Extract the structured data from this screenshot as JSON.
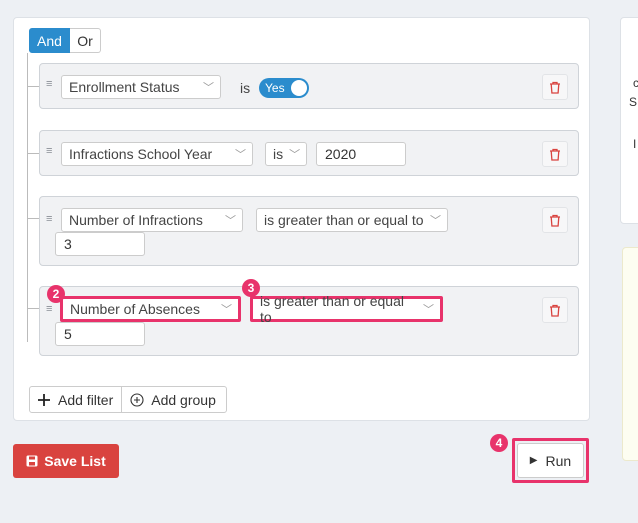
{
  "group": {
    "and_label": "And",
    "or_label": "Or"
  },
  "rules": [
    {
      "field": "Enrollment Status",
      "operator": "is",
      "toggle_label": "Yes"
    },
    {
      "field": "Infractions School Year",
      "operator": "is",
      "value": "2020"
    },
    {
      "field": "Number of Infractions",
      "operator": "is greater than or equal to",
      "value": "3"
    },
    {
      "field": "Number of Absences",
      "operator": "is greater than or equal to",
      "value": "5"
    }
  ],
  "annotations": {
    "badge_field": "2",
    "badge_operator": "3",
    "badge_run": "4"
  },
  "actions": {
    "add_filter": "Add filter",
    "add_group": "Add group",
    "save_list": "Save List",
    "run": "Run"
  },
  "right_panel": {
    "frag1": "c",
    "frag2": "S",
    "frag3": "I"
  },
  "colors": {
    "primary": "#2b8ccd",
    "danger": "#d9433f",
    "highlight": "#e8336b"
  }
}
